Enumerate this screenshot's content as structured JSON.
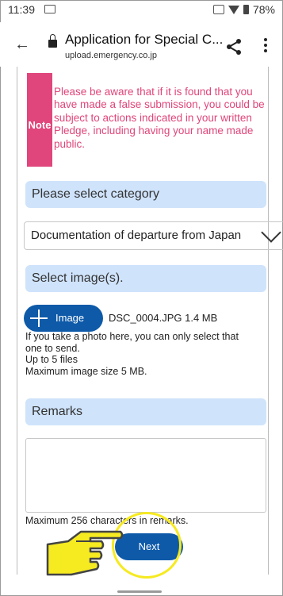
{
  "status": {
    "time": "11:39",
    "battery": "78%"
  },
  "toolbar": {
    "title": "Application for Special C...",
    "url": "upload.emergency.co.jp"
  },
  "note": {
    "label": "Note",
    "text": "Please be aware that if it is found that you have made a false submission, you could be subject to actions indicated in your written Pledge, including having your name made public."
  },
  "category": {
    "header": "Please select category",
    "selected": "Documentation of departure from Japan"
  },
  "images": {
    "header": "Select image(s).",
    "button_label": "Image",
    "file_name": "DSC_0004.JPG",
    "file_size": "1.4 MB",
    "help_1": "If you take a photo here, you can only select that one to send.",
    "help_2": "Up to 5 files",
    "help_3": "Maximum image size 5 MB."
  },
  "remarks": {
    "header": "Remarks",
    "value": "",
    "limit_text": "Maximum 256 characters in remarks."
  },
  "actions": {
    "next_label": "Next"
  },
  "colors": {
    "accent": "#0e5aa9",
    "note": "#e0457b",
    "section_bg": "#cfe3fb",
    "highlight": "#f6ea21"
  },
  "icons": [
    "back-arrow-icon",
    "lock-icon",
    "share-icon",
    "more-vert-icon",
    "plus-icon",
    "chevron-down-icon",
    "pointing-hand-icon"
  ]
}
